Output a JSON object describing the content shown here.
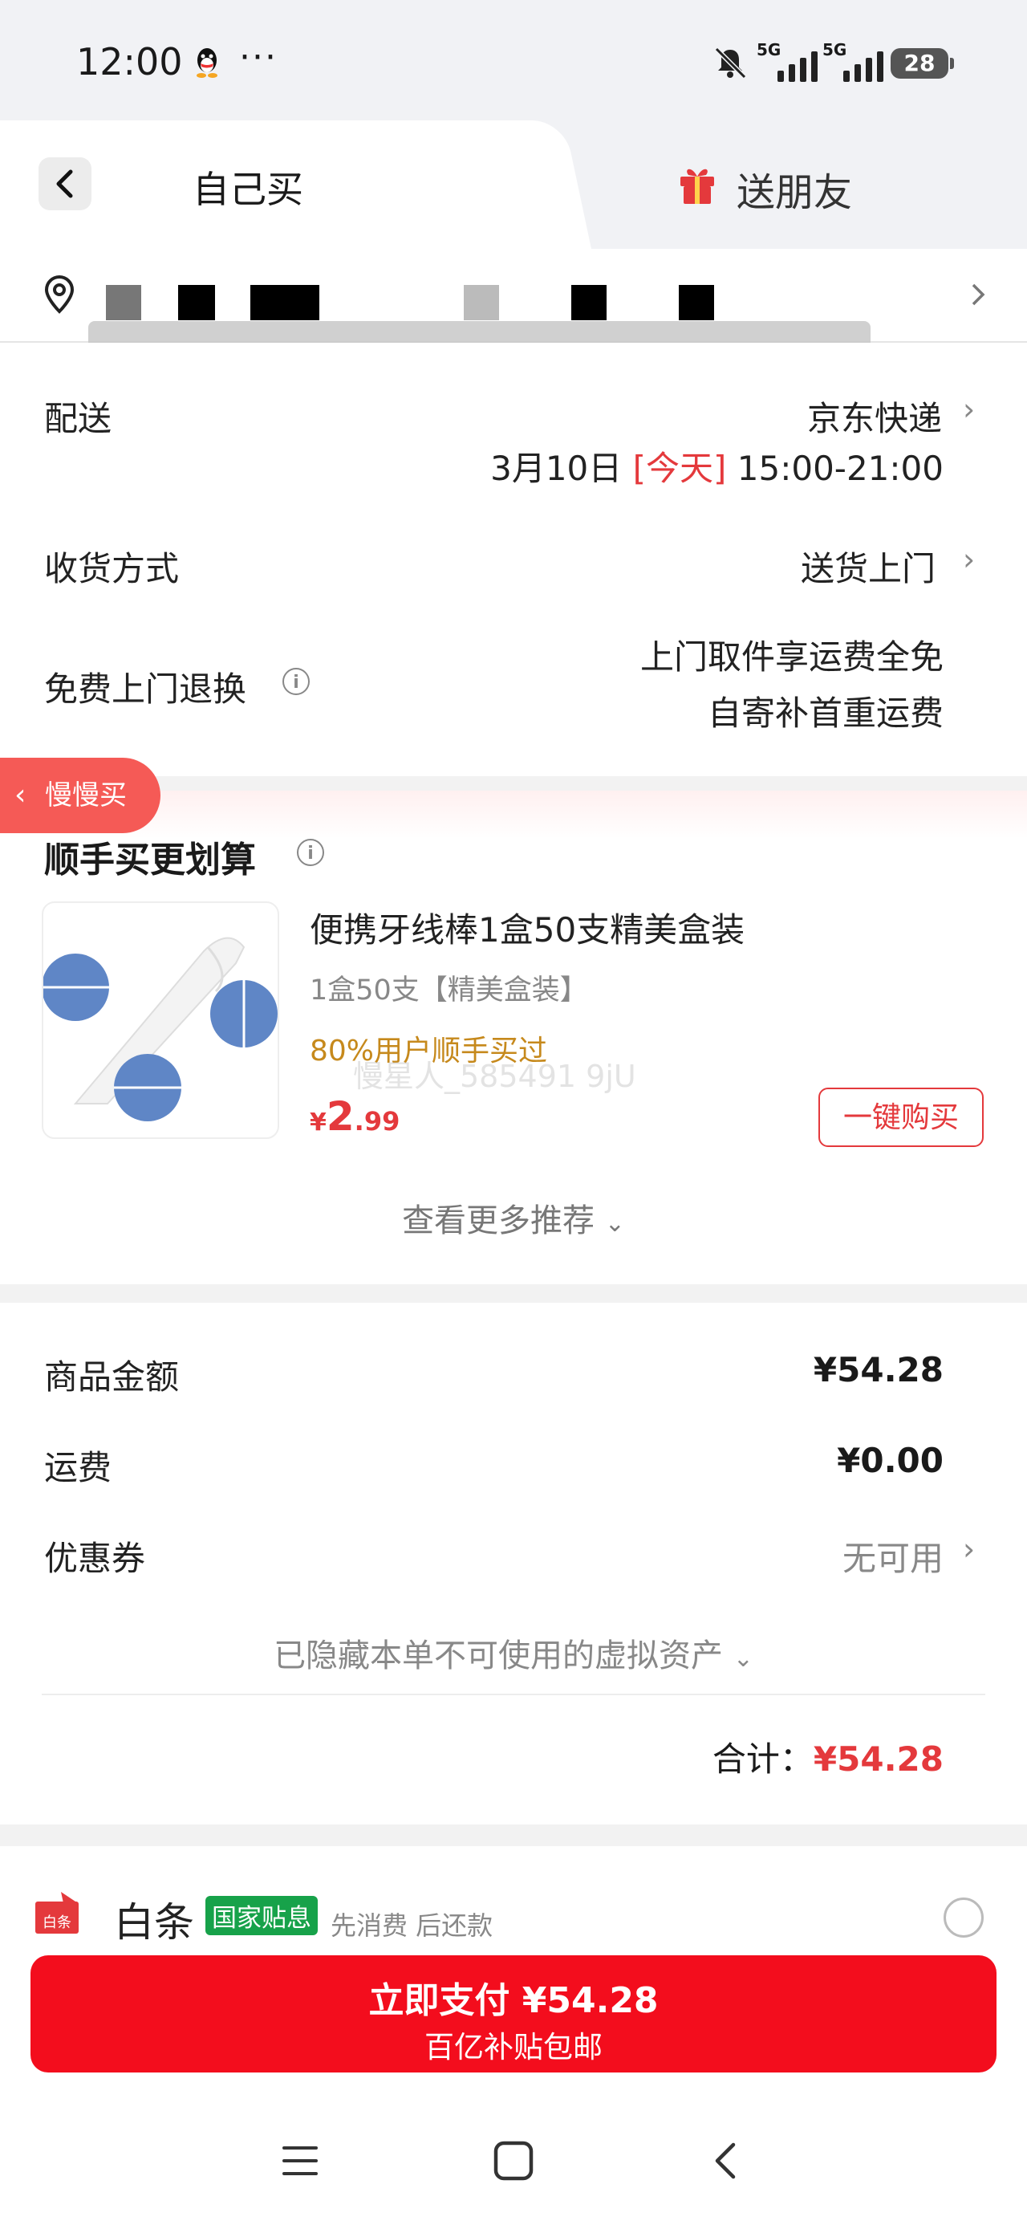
{
  "status_bar": {
    "time": "12:00",
    "dots": "···",
    "signal1": "5G",
    "signal2": "5G",
    "battery": "28"
  },
  "tabs": {
    "self_buy": "自己买",
    "gift": "送朋友"
  },
  "delivery": {
    "label": "配送",
    "carrier": "京东快递",
    "date": "3月10日",
    "today": "[今天]",
    "time_range": "15:00-21:00",
    "receive_label": "收货方式",
    "receive_value": "送货上门",
    "return_label": "免费上门退换",
    "return_line1": "上门取件享运费全免",
    "return_line2": "自寄补首重运费"
  },
  "slow_buy": "慢慢买",
  "recommend": {
    "title": "顺手买更划算",
    "product": {
      "name": "便携牙线棒1盒50支精美盒装",
      "spec": "1盒50支【精美盒装】",
      "buyers": "80%用户顺手买过",
      "price_symbol": "¥",
      "price_int": "2",
      "price_dec": ".99",
      "buy_label": "一键购买"
    },
    "watermark": "慢星人_585491 9jU",
    "see_more": "查看更多推荐"
  },
  "summary": {
    "goods_label": "商品金额",
    "goods_value": "¥54.28",
    "shipping_label": "运费",
    "shipping_value": "¥0.00",
    "coupon_label": "优惠券",
    "coupon_value": "无可用",
    "hidden_assets": "已隐藏本单不可使用的虚拟资产",
    "total_label": "合计：",
    "total_value": "¥54.28"
  },
  "payment": {
    "baitiao_icon_text": "白条",
    "baitiao": "白条",
    "gov_badge": "国家贴息",
    "pay_later": "先消费 后还款",
    "pay_button": "立即支付 ¥54.28",
    "pay_sub": "百亿补贴包邮"
  },
  "colors": {
    "accent_red": "#e4393c",
    "pay_button": "#f30d1d",
    "gov_green": "#17a24a",
    "buyers_orange": "#c6891c"
  }
}
